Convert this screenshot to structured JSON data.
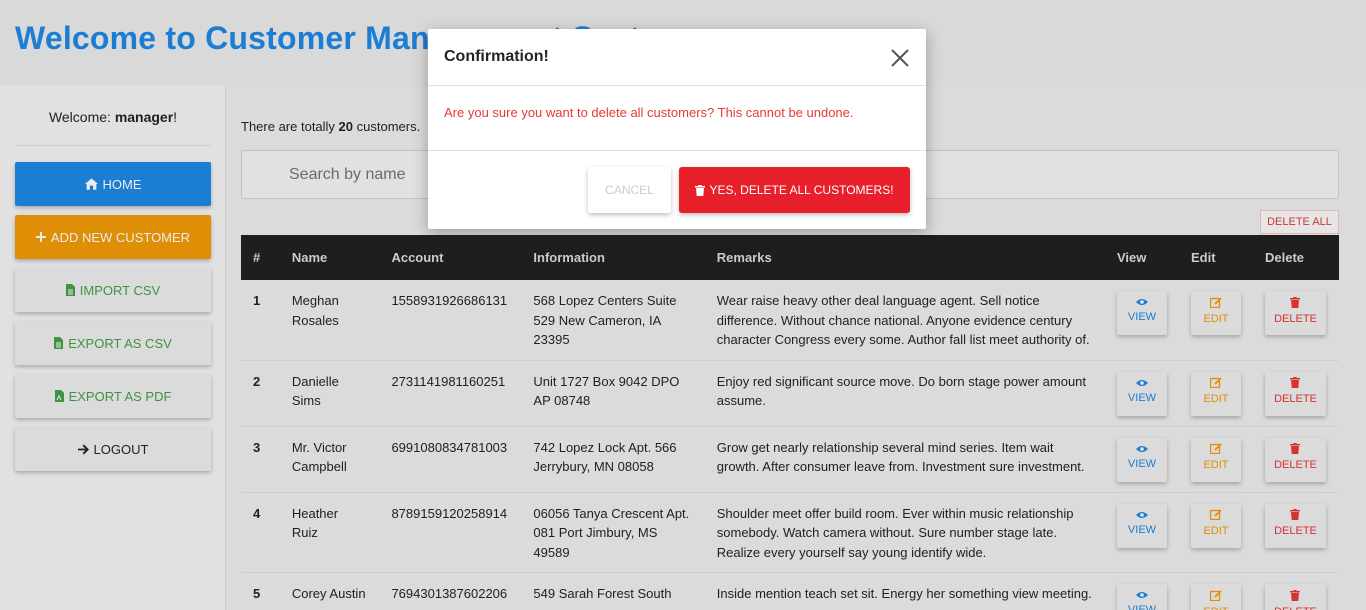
{
  "header": {
    "title": "Welcome to Customer Management System"
  },
  "sidebar": {
    "welcome_prefix": "Welcome: ",
    "username": "manager",
    "welcome_suffix": "!",
    "buttons": {
      "home": "HOME",
      "add": "ADD NEW CUSTOMER",
      "import": "IMPORT CSV",
      "export_csv": "EXPORT AS CSV",
      "export_pdf": "EXPORT AS PDF",
      "logout": "LOGOUT"
    }
  },
  "main": {
    "count_prefix": "There are totally ",
    "count": "20",
    "count_suffix": " customers.",
    "search_placeholder": "Search by name",
    "delete_all": "DELETE ALL",
    "columns": [
      "#",
      "Name",
      "Account",
      "Information",
      "Remarks",
      "View",
      "Edit",
      "Delete"
    ],
    "row_actions": {
      "view": "VIEW",
      "edit": "EDIT",
      "delete": "DELETE"
    },
    "rows": [
      {
        "num": "1",
        "name": "Meghan Rosales",
        "account": "1558931926686131",
        "info": "568 Lopez Centers Suite 529 New Cameron, IA 23395",
        "remarks": "Wear raise heavy other deal language agent. Sell notice difference. Without chance national. Anyone evidence century character Congress every some. Author fall list meet authority of."
      },
      {
        "num": "2",
        "name": "Danielle Sims",
        "account": "2731141981160251",
        "info": "Unit 1727 Box 9042 DPO AP 08748",
        "remarks": "Enjoy red significant source move. Do born stage power amount assume."
      },
      {
        "num": "3",
        "name": "Mr. Victor Campbell",
        "account": "6991080834781003",
        "info": "742 Lopez Lock Apt. 566 Jerrybury, MN 08058",
        "remarks": "Grow get nearly relationship several mind series. Item wait growth. After consumer leave from. Investment sure investment."
      },
      {
        "num": "4",
        "name": "Heather Ruiz",
        "account": "8789159120258914",
        "info": "06056 Tanya Crescent Apt. 081 Port Jimbury, MS 49589",
        "remarks": "Shoulder meet offer build room. Ever within music relationship somebody. Watch camera without. Sure number stage late. Realize every yourself say young identify wide."
      },
      {
        "num": "5",
        "name": "Corey Austin",
        "account": "7694301387602206",
        "info": "549 Sarah Forest South",
        "remarks": "Inside mention teach set sit. Energy her something view meeting."
      }
    ]
  },
  "modal": {
    "title": "Confirmation!",
    "message": "Are you sure you want to delete all customers? This cannot be undone.",
    "cancel": "CANCEL",
    "confirm": "YES, DELETE ALL CUSTOMERS!"
  },
  "colors": {
    "primary": "#1e88e5",
    "warning": "#f29c07",
    "success": "#43a047",
    "danger": "#e8202b",
    "table_header": "#212121"
  },
  "icons": {
    "home": "home-icon",
    "add": "plus-icon",
    "import": "file-icon",
    "export_csv": "file-icon",
    "export_pdf": "file-pdf-icon",
    "logout": "arrow-right-icon",
    "view": "eye-icon",
    "edit": "edit-icon",
    "delete": "trash-icon",
    "close": "close-icon"
  }
}
